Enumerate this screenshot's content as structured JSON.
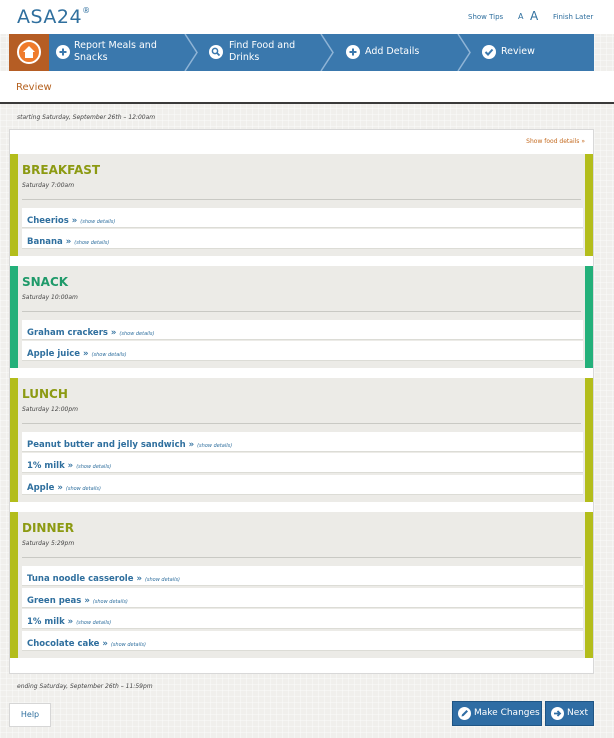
{
  "header": {
    "logo": "ASA24",
    "logo_mark": "®",
    "show_tips": "Show Tips",
    "font_small": "A",
    "font_large": "A",
    "finish_later": "Finish Later"
  },
  "nav": {
    "home_icon": "home-icon",
    "steps": [
      {
        "label": "Report Meals and Snacks",
        "icon": "plus-icon"
      },
      {
        "label": "Find Food and Drinks",
        "icon": "search-icon"
      },
      {
        "label": "Add Details",
        "icon": "plus-icon"
      },
      {
        "label": "Review",
        "icon": "check-icon"
      }
    ]
  },
  "page": {
    "title": "Review",
    "starting": "starting Saturday, September 26th – 12:00am",
    "ending": "ending Saturday, September 26th – 11:59pm",
    "show_food_details": "Show food details »"
  },
  "show_details_label": "(show details)",
  "meals": [
    {
      "name": "BREAKFAST",
      "time": "Saturday 7:00am",
      "color": "#b3bd1b",
      "title_color": "#8c9a12",
      "foods": [
        "Cheerios »",
        "Banana »"
      ]
    },
    {
      "name": "SNACK",
      "time": "Saturday 10:00am",
      "color": "#23b07a",
      "title_color": "#1f9a6a",
      "foods": [
        "Graham crackers »",
        "Apple juice »"
      ]
    },
    {
      "name": "LUNCH",
      "time": "Saturday 12:00pm",
      "color": "#b3bd1b",
      "title_color": "#8c9a12",
      "foods": [
        "Peanut butter and jelly sandwich »",
        "1% milk »",
        "Apple »"
      ]
    },
    {
      "name": "DINNER",
      "time": "Saturday 5:29pm",
      "color": "#b3bd1b",
      "title_color": "#8c9a12",
      "foods": [
        "Tuna noodle casserole »",
        "Green peas »",
        "1% milk »",
        "Chocolate cake »"
      ]
    }
  ],
  "buttons": {
    "help": "Help",
    "make_changes": "Make Changes",
    "next": "Next"
  }
}
